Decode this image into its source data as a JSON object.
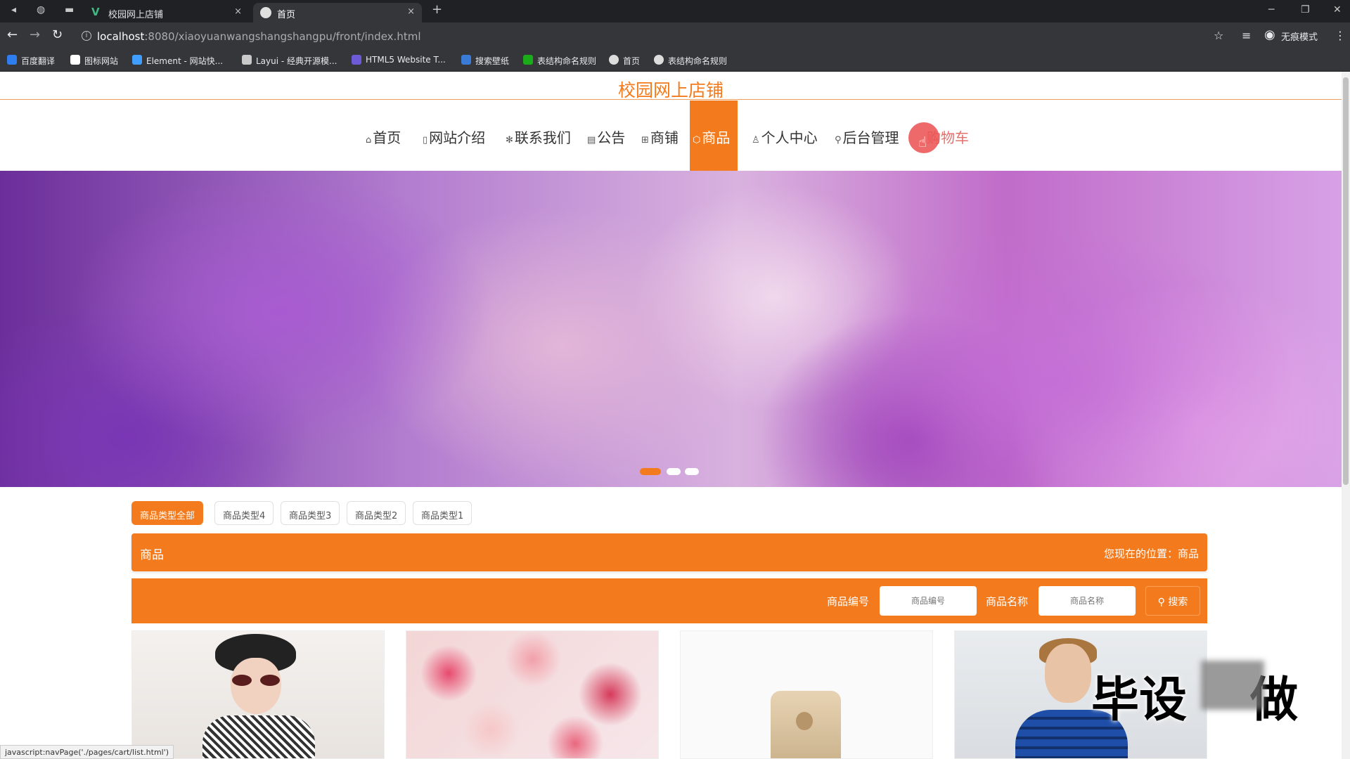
{
  "browser": {
    "tabs": [
      {
        "title": "校园网上店铺",
        "active": false
      },
      {
        "title": "首页",
        "active": true
      }
    ],
    "new_tab_label": "+",
    "close_glyph": "×",
    "url": {
      "host": "localhost",
      "path": ":8080/xiaoyuanwangshangshangpu/front/index.html"
    },
    "incognito_label": "无痕模式",
    "bookmarks": [
      {
        "label": "百度翻译",
        "color": "#2f7ef0"
      },
      {
        "label": "图标网站",
        "color": "#ffffff"
      },
      {
        "label": "Element - 网站快...",
        "color": "#409eff"
      },
      {
        "label": "Layui - 经典开源模...",
        "color": "#c9c9c9"
      },
      {
        "label": "HTML5 Website T...",
        "color": "#6b5bd6"
      },
      {
        "label": "搜索壁纸",
        "color": "#3a7bd5"
      },
      {
        "label": "表结构命名规则",
        "color": "#1aad19"
      },
      {
        "label": "首页",
        "color": "#dddddd"
      },
      {
        "label": "表结构命名规则",
        "color": "#dddddd"
      }
    ]
  },
  "site": {
    "title": "校园网上店铺",
    "accent": "#f37b1d",
    "nav": [
      {
        "label": "首页",
        "icon": "home-icon",
        "glyph": "⌂"
      },
      {
        "label": "网站介绍",
        "icon": "doc-icon",
        "glyph": "▯"
      },
      {
        "label": "联系我们",
        "icon": "snowflake-icon",
        "glyph": "✻"
      },
      {
        "label": "公告",
        "icon": "notice-icon",
        "glyph": "▤"
      },
      {
        "label": "商铺",
        "icon": "grid-icon",
        "glyph": "⊞"
      },
      {
        "label": "商品",
        "icon": "tag-icon",
        "glyph": "⬡",
        "active": true
      },
      {
        "label": "个人中心",
        "icon": "user-icon",
        "glyph": "♙"
      },
      {
        "label": "后台管理",
        "icon": "link-icon",
        "glyph": "⚲"
      },
      {
        "label": "购物车",
        "icon": "cart-icon",
        "glyph": ""
      }
    ],
    "carousel": {
      "slides": 3,
      "active_index": 0
    },
    "categories": [
      "商品类型全部",
      "商品类型4",
      "商品类型3",
      "商品类型2",
      "商品类型1"
    ],
    "section": {
      "title": "商品",
      "location": "您现在的位置：商品"
    },
    "search": {
      "code_label": "商品编号",
      "code_placeholder": "商品编号",
      "name_label": "商品名称",
      "name_placeholder": "商品名称",
      "button": "搜索"
    },
    "products": [
      {
        "image": "woman-with-hat"
      },
      {
        "image": "roses-bouquet"
      },
      {
        "image": "gold-iphone"
      },
      {
        "image": "man-blue-sweater"
      }
    ]
  },
  "overlay": {
    "watermark": "毕设",
    "watermark_tail": "做"
  },
  "status_url": "javascript:navPage('./pages/cart/list.html')"
}
